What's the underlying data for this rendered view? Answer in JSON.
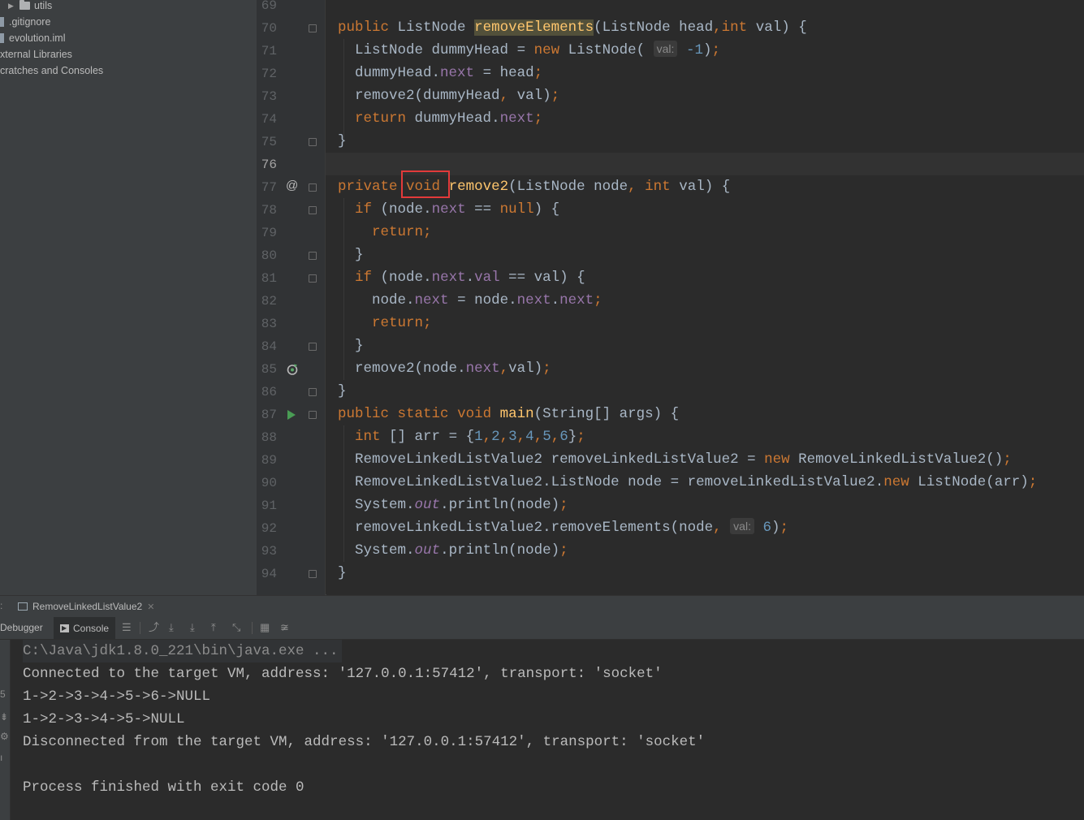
{
  "project_tree": {
    "items": [
      {
        "label": "utils",
        "type": "folder"
      },
      {
        "label": ".gitignore",
        "type": "file"
      },
      {
        "label": "evolution.iml",
        "type": "file"
      },
      {
        "label": "xternal Libraries",
        "type": "libraries"
      },
      {
        "label": "cratches and Consoles",
        "type": "scratches"
      }
    ]
  },
  "editor": {
    "partial_top_line": "69",
    "current_line": "76",
    "lines": {
      "l70": {
        "no": "70"
      },
      "l71": {
        "no": "71"
      },
      "l72": {
        "no": "72"
      },
      "l73": {
        "no": "73"
      },
      "l74": {
        "no": "74"
      },
      "l75": {
        "no": "75"
      },
      "l76": {
        "no": "76"
      },
      "l77": {
        "no": "77"
      },
      "l78": {
        "no": "78"
      },
      "l79": {
        "no": "79"
      },
      "l80": {
        "no": "80"
      },
      "l81": {
        "no": "81"
      },
      "l82": {
        "no": "82"
      },
      "l83": {
        "no": "83"
      },
      "l84": {
        "no": "84"
      },
      "l85": {
        "no": "85"
      },
      "l86": {
        "no": "86"
      },
      "l87": {
        "no": "87"
      },
      "l88": {
        "no": "88"
      },
      "l89": {
        "no": "89"
      },
      "l90": {
        "no": "90"
      },
      "l91": {
        "no": "91"
      },
      "l92": {
        "no": "92"
      },
      "l93": {
        "no": "93"
      },
      "l94": {
        "no": "94"
      }
    },
    "tokens": {
      "public": "public",
      "private": "private",
      "static": "static",
      "void": "void",
      "return": "return",
      "new": "new",
      "if": "if",
      "int": "int",
      "null": "null",
      "ListNode": "ListNode",
      "removeElements": "removeElements",
      "remove2": "remove2",
      "main": "main",
      "head": "head",
      "val": "val",
      "node": "node",
      "next": "next",
      "dummyHead": "dummyHead",
      "args": "args",
      "arr": "arr",
      "out": "out",
      "hint_val": "val:",
      "minus_one": "-1",
      "cls_instance": "removeLinkedListValue2",
      "cls_name": "RemoveLinkedListValue2",
      "string_arr": "String[]",
      "system": "System",
      "println": "println",
      "nums": [
        "1",
        "2",
        "3",
        "4",
        "5",
        "6"
      ],
      "six": "6"
    }
  },
  "run_window": {
    "tab_label": "RemoveLinkedListValue2",
    "debugger_tab": "Debugger",
    "console_tab": "Console",
    "output": [
      "C:\\Java\\jdk1.8.0_221\\bin\\java.exe ...",
      "Connected to the target VM, address: '127.0.0.1:57412', transport: 'socket'",
      "1->2->3->4->5->6->NULL",
      "1->2->3->4->5->NULL",
      "Disconnected from the target VM, address: '127.0.0.1:57412', transport: 'socket'",
      "",
      "Process finished with exit code 0"
    ]
  },
  "colors": {
    "keyword": "#cc7832",
    "field": "#9876aa",
    "number": "#6897bb",
    "method_decl": "#ffc66d",
    "highlight_box": "#e23a3a"
  },
  "icons": [
    "folder-icon",
    "file-icon",
    "fold-marker-icon",
    "override-icon",
    "recursion-icon",
    "run-icon",
    "console-icon"
  ]
}
